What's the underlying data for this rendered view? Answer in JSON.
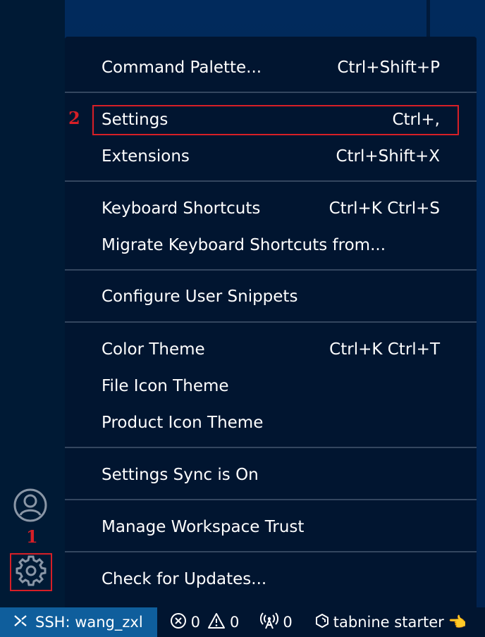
{
  "menu": {
    "items": [
      {
        "label": "Command Palette...",
        "shortcut": "Ctrl+Shift+P"
      },
      {
        "label": "Settings",
        "shortcut": "Ctrl+,"
      },
      {
        "label": "Extensions",
        "shortcut": "Ctrl+Shift+X"
      },
      {
        "label": "Keyboard Shortcuts",
        "shortcut": "Ctrl+K Ctrl+S"
      },
      {
        "label": "Migrate Keyboard Shortcuts from...",
        "shortcut": ""
      },
      {
        "label": "Configure User Snippets",
        "shortcut": ""
      },
      {
        "label": "Color Theme",
        "shortcut": "Ctrl+K Ctrl+T"
      },
      {
        "label": "File Icon Theme",
        "shortcut": ""
      },
      {
        "label": "Product Icon Theme",
        "shortcut": ""
      },
      {
        "label": "Settings Sync is On",
        "shortcut": ""
      },
      {
        "label": "Manage Workspace Trust",
        "shortcut": ""
      },
      {
        "label": "Check for Updates...",
        "shortcut": ""
      }
    ]
  },
  "annotations": {
    "marker_1": "1",
    "marker_2": "2",
    "color": "#d71f27"
  },
  "activity_bar": {
    "account_icon": "account-icon",
    "manage_icon": "gear-icon"
  },
  "status_bar": {
    "remote_label": "SSH: wang_zxl",
    "errors": "0",
    "warnings": "0",
    "ports": "0",
    "tabnine_label": "tabnine starter",
    "tabnine_emoji": "👈"
  }
}
